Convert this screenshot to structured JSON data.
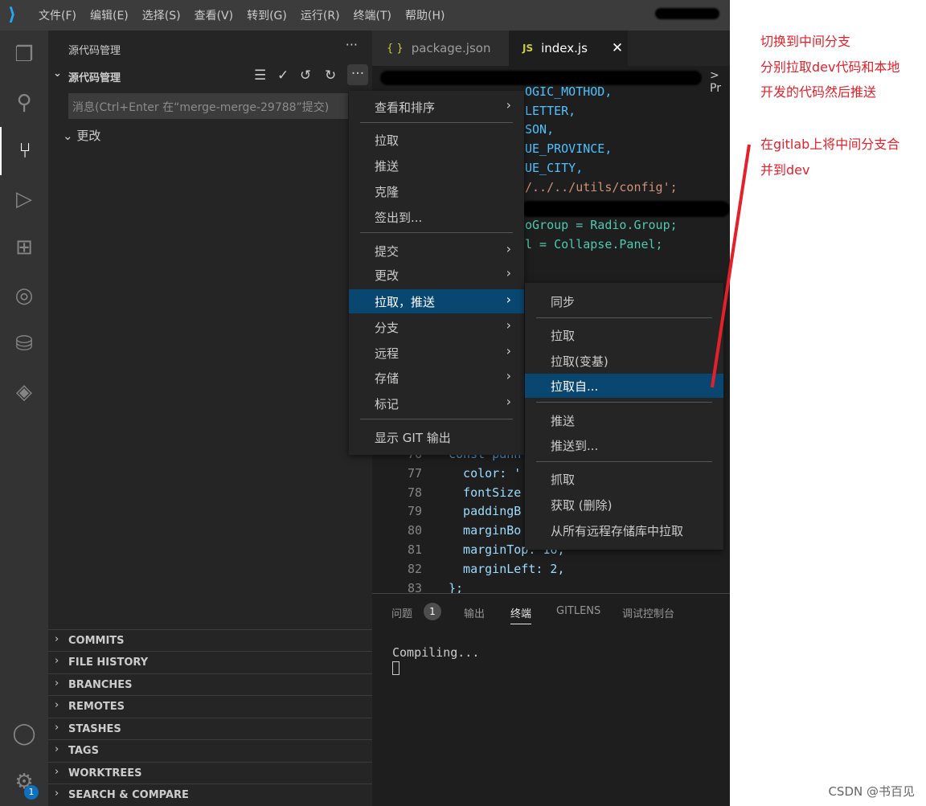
{
  "titlebar": {
    "menu": [
      "文件(F)",
      "编辑(E)",
      "选择(S)",
      "查看(V)",
      "转到(G)",
      "运行(R)",
      "终端(T)",
      "帮助(H)"
    ]
  },
  "activity": {
    "icons": [
      "files-icon",
      "search-icon",
      "source-control-icon",
      "run-debug-icon",
      "extensions-icon",
      "gitlens-icon",
      "database-icon",
      "layers-icon",
      "account-icon",
      "settings-icon"
    ],
    "settings_badge": "1"
  },
  "sidebar": {
    "title": "源代码管理",
    "section": "源代码管理",
    "message_placeholder": "消息(Ctrl+Enter 在“merge-merge-29788”提交)",
    "changes": "更改",
    "bottom_sections": [
      "COMMITS",
      "FILE HISTORY",
      "BRANCHES",
      "REMOTES",
      "STASHES",
      "TAGS",
      "WORKTREES",
      "SEARCH & COMPARE"
    ]
  },
  "editor": {
    "tabs": [
      {
        "icon": "{ }",
        "label": "package.json"
      },
      {
        "icon": "JS",
        "label": "index.js"
      }
    ],
    "breadcrumb_tail": "> Pr",
    "top_lines": [
      "OGIC_MOTHOD,",
      "LETTER,",
      "SON,",
      "UE_PROVINCE,",
      "UE_CITY,",
      "/../../utils/config';",
      "",
      "oGroup = Radio.Group;",
      "l = Collapse.Panel;"
    ],
    "lines": [
      {
        "n": "76",
        "t": "const pann"
      },
      {
        "n": "77",
        "t": "  color: '"
      },
      {
        "n": "78",
        "t": "  fontSize"
      },
      {
        "n": "79",
        "t": "  paddingB"
      },
      {
        "n": "80",
        "t": "  marginBo"
      },
      {
        "n": "81",
        "t": "  marginTop: 16,"
      },
      {
        "n": "82",
        "t": "  marginLeft: 2,"
      },
      {
        "n": "83",
        "t": "};"
      }
    ]
  },
  "panel": {
    "tabs": [
      "问题",
      "输出",
      "终端",
      "GITLENS",
      "调试控制台"
    ],
    "problems_badge": "1",
    "active_tab": "终端",
    "terminal_output": "Compiling..."
  },
  "menu": {
    "items": [
      "查看和排序",
      "拉取",
      "推送",
      "克隆",
      "签出到...",
      "提交",
      "更改",
      "拉取，推送",
      "分支",
      "远程",
      "存储",
      "标记",
      "显示 GIT 输出"
    ],
    "highlighted": "拉取，推送"
  },
  "submenu": {
    "items": [
      "同步",
      "拉取",
      "拉取(变基)",
      "拉取自...",
      "推送",
      "推送到...",
      "抓取",
      "获取 (删除)",
      "从所有远程存储库中拉取"
    ],
    "highlighted": "拉取自..."
  },
  "notes": {
    "lines": [
      "切换到中间分支",
      "分别拉取dev代码和本地",
      "开发的代码然后推送",
      "在gitlab上将中间分支合",
      "并到dev"
    ],
    "watermark": "CSDN @书百见",
    "color": "#e5202a"
  }
}
